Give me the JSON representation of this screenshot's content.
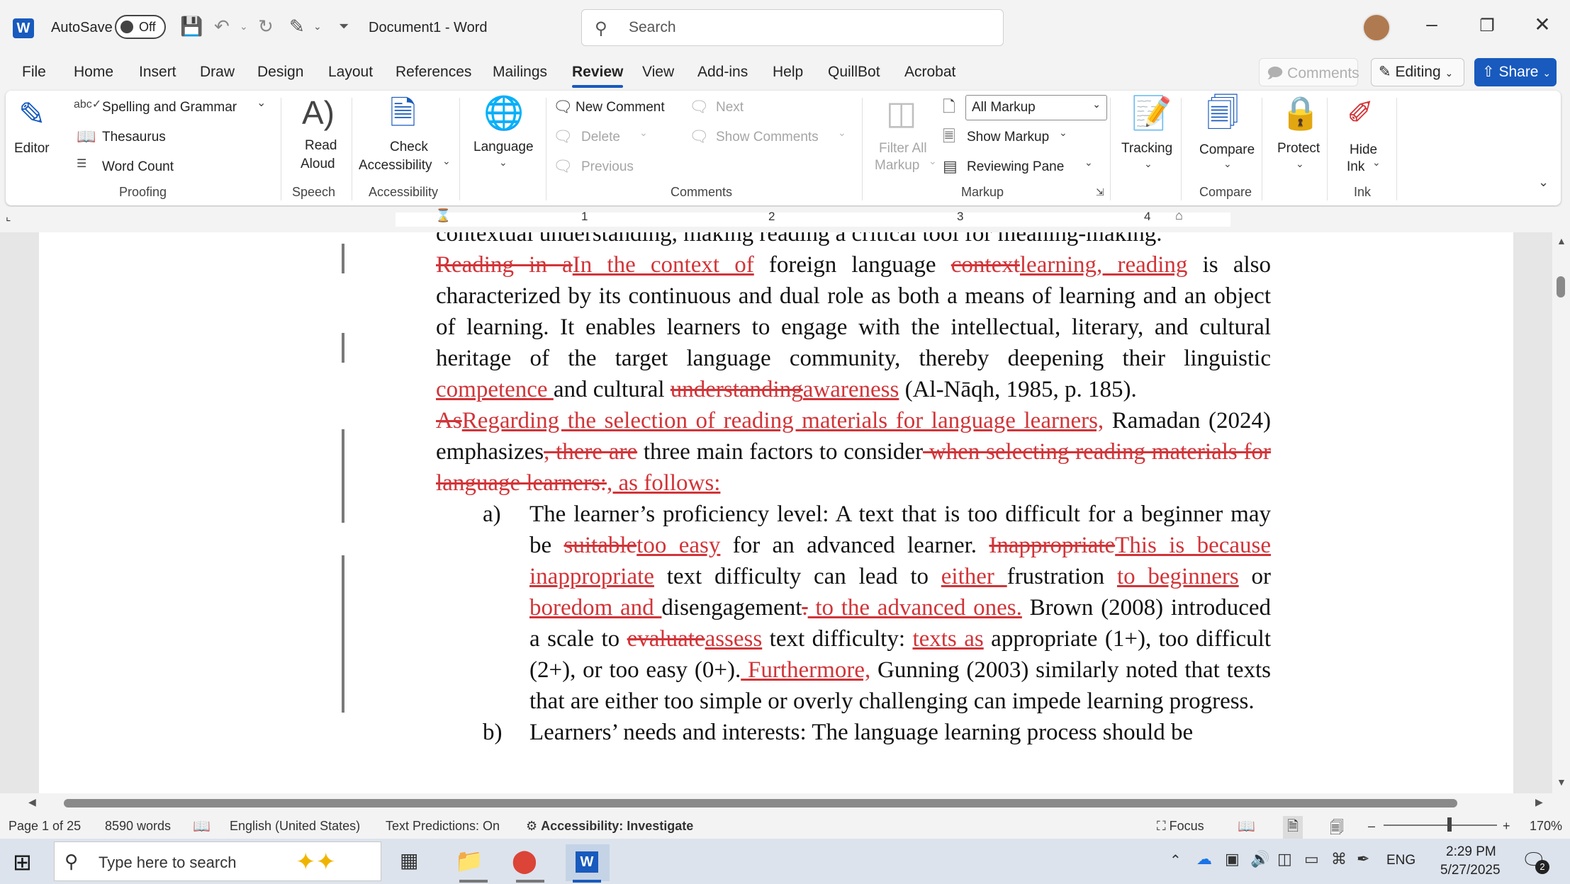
{
  "titlebar": {
    "autosave_label": "AutoSave",
    "autosave_state": "Off",
    "doc_title": "Document1  -  Word",
    "search_placeholder": "Search"
  },
  "menu": {
    "items": [
      "File",
      "Home",
      "Insert",
      "Draw",
      "Design",
      "Layout",
      "References",
      "Mailings",
      "Review",
      "View",
      "Add-ins",
      "Help",
      "QuillBot",
      "Acrobat"
    ],
    "active": "Review",
    "comments_label": "Comments",
    "editing_label": "Editing",
    "share_label": "Share"
  },
  "ribbon": {
    "proofing": {
      "editor": "Editor",
      "spelling": "Spelling and Grammar",
      "thesaurus": "Thesaurus",
      "word_count": "Word Count",
      "group": "Proofing"
    },
    "speech": {
      "read_aloud_1": "Read",
      "read_aloud_2": "Aloud",
      "group": "Speech"
    },
    "accessibility": {
      "check_1": "Check",
      "check_2": "Accessibility",
      "group": "Accessibility"
    },
    "language": {
      "label": "Language"
    },
    "comments": {
      "new": "New Comment",
      "delete": "Delete",
      "previous": "Previous",
      "next": "Next",
      "show": "Show Comments",
      "group": "Comments"
    },
    "markup": {
      "filter_1": "Filter All",
      "filter_2": "Markup",
      "selected": "All Markup",
      "show_markup": "Show Markup",
      "reviewing_pane": "Reviewing Pane",
      "group": "Markup"
    },
    "tracking": {
      "label": "Tracking"
    },
    "compare": {
      "label": "Compare",
      "group": "Compare"
    },
    "protect": {
      "label": "Protect"
    },
    "ink": {
      "hide_1": "Hide",
      "hide_2": "Ink",
      "group": "Ink"
    }
  },
  "ruler": {
    "numbers": [
      "1",
      "2",
      "3",
      "4"
    ]
  },
  "document": {
    "top_line": "contextual understanding, making reading a critical tool for meaning-making.",
    "p1": [
      {
        "t": "del",
        "v": "Reading in a"
      },
      {
        "t": "ins",
        "v": "In the context of"
      },
      {
        "t": "n",
        "v": " foreign language "
      },
      {
        "t": "del",
        "v": "context"
      },
      {
        "t": "ins",
        "v": "learning, reading"
      },
      {
        "t": "n",
        "v": " is also characterized by its continuous and dual role as both a means of learning and an object of learning. It enables learners to engage with the intellectual, literary, and cultural heritage of the target language community, thereby deepening their linguistic "
      },
      {
        "t": "ins",
        "v": "competence "
      },
      {
        "t": "n",
        "v": "and cultural "
      },
      {
        "t": "del",
        "v": "understanding"
      },
      {
        "t": "ins",
        "v": "awareness"
      },
      {
        "t": "n",
        "v": " (Al-Nāqh, 1985, p. 185)."
      }
    ],
    "p2": [
      {
        "t": "del",
        "v": "As"
      },
      {
        "t": "ins",
        "v": "Regarding the selection of reading materials for language learners,"
      },
      {
        "t": "n",
        "v": " Ramadan (2024) emphasizes"
      },
      {
        "t": "del",
        "v": ", there are"
      },
      {
        "t": "n",
        "v": " three main factors to consider"
      },
      {
        "t": "del",
        "v": " when selecting reading materials for language learners:"
      },
      {
        "t": "ins",
        "v": ", as follows:"
      }
    ],
    "item_a_label": "a)",
    "item_a": [
      {
        "t": "n",
        "v": "The learner’s proficiency level: A text that is too difficult for a beginner may be "
      },
      {
        "t": "del",
        "v": "suitable"
      },
      {
        "t": "ins",
        "v": "too easy"
      },
      {
        "t": "n",
        "v": " for an advanced learner. "
      },
      {
        "t": "del",
        "v": "Inappropriate"
      },
      {
        "t": "ins",
        "v": "This is because inappropriate"
      },
      {
        "t": "n",
        "v": " text difficulty can lead to "
      },
      {
        "t": "ins",
        "v": "either "
      },
      {
        "t": "n",
        "v": "frustration "
      },
      {
        "t": "ins",
        "v": "to beginners"
      },
      {
        "t": "n",
        "v": " or "
      },
      {
        "t": "ins",
        "v": "boredom and "
      },
      {
        "t": "n",
        "v": "disengagement"
      },
      {
        "t": "del",
        "v": "."
      },
      {
        "t": "ins",
        "v": " to the advanced ones."
      },
      {
        "t": "n",
        "v": " Brown (2008) introduced a scale to "
      },
      {
        "t": "del",
        "v": "evaluate"
      },
      {
        "t": "ins",
        "v": "assess"
      },
      {
        "t": "n",
        "v": " text difficulty: "
      },
      {
        "t": "ins",
        "v": "texts as"
      },
      {
        "t": "n",
        "v": " appropriate (1+), too difficult (2+), or too easy (0+)."
      },
      {
        "t": "ins",
        "v": " Furthermore,"
      },
      {
        "t": "n",
        "v": " Gunning (2003) similarly noted that texts that are either too simple or overly challenging can impede learning progress."
      }
    ],
    "item_b_label": "b)",
    "item_b": "Learners’ needs and interests: The language learning process should be"
  },
  "status": {
    "page": "Page 1 of 25",
    "words": "8590 words",
    "language": "English (United States)",
    "predictions": "Text Predictions: On",
    "accessibility": "Accessibility: Investigate",
    "focus": "Focus",
    "zoom": "170%"
  },
  "taskbar": {
    "search_placeholder": "Type here to search",
    "lang": "ENG",
    "time": "2:29 PM",
    "date": "5/27/2025",
    "notif_count": "2"
  }
}
